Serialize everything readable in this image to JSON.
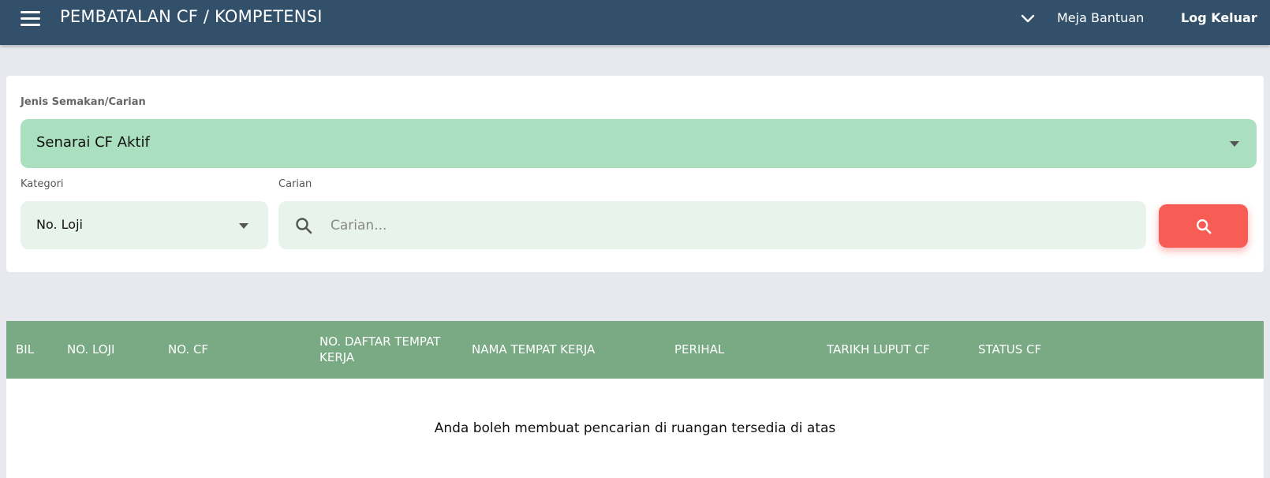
{
  "header": {
    "title": "PEMBATALAN CF / KOMPETENSI",
    "help_label": "Meja Bantuan",
    "logout_label": "Log Keluar"
  },
  "search": {
    "jenis_label": "Jenis Semakan/Carian",
    "jenis_value": "Senarai CF Aktif",
    "kategori_label": "Kategori",
    "kategori_value": "No. Loji",
    "carian_label": "Carian",
    "carian_placeholder": "Carian...",
    "carian_value": ""
  },
  "table": {
    "columns": [
      "BIL",
      "NO. LOJI",
      "NO. CF",
      "NO. DAFTAR TEMPAT KERJA",
      "NAMA TEMPAT KERJA",
      "PERIHAL",
      "TARIKH LUPUT CF",
      "STATUS CF"
    ],
    "empty_message": "Anda boleh membuat pencarian di ruangan tersedia di atas"
  },
  "colors": {
    "topbar": "#33506b",
    "jenis_select_bg": "#aadfbf",
    "field_bg": "#e8f3ec",
    "search_button": "#f75c55",
    "table_header": "#79aa84",
    "page_bg": "#e8e9ee"
  },
  "icons": {
    "menu": "hamburger-menu-icon",
    "dropdown": "chevron-down-icon",
    "search": "search-icon"
  }
}
